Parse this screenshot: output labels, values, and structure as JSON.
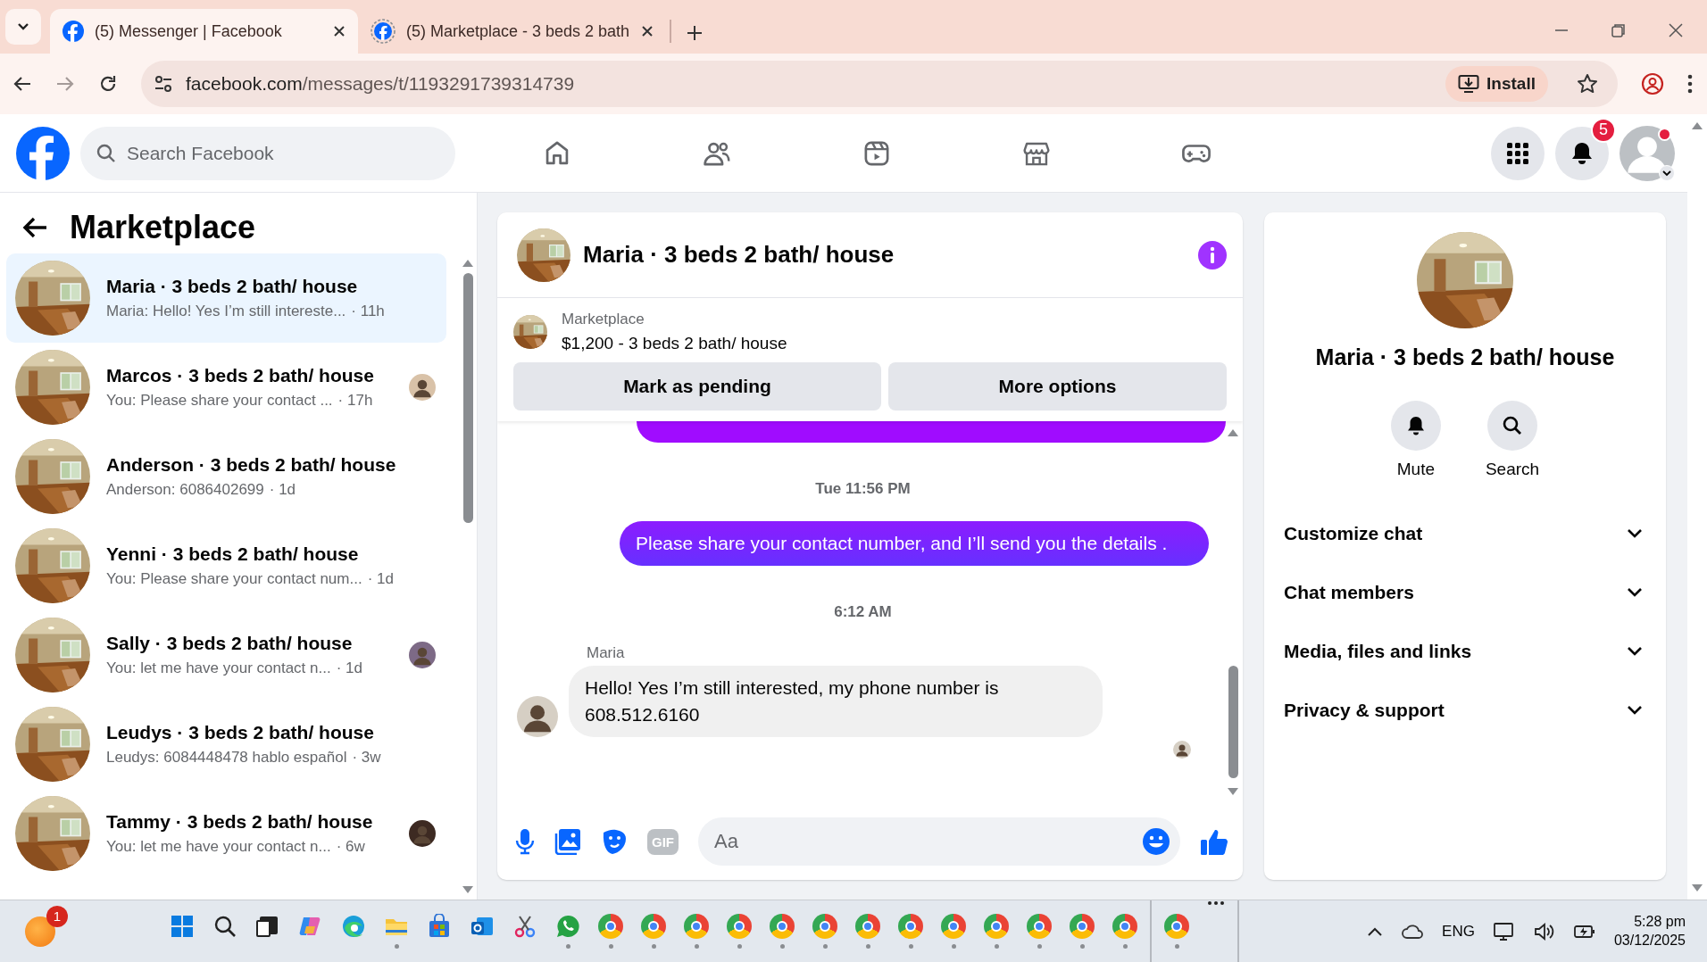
{
  "browser": {
    "tabs": [
      {
        "title": "(5) Messenger | Facebook",
        "selected": true,
        "loading": false
      },
      {
        "title": "(5) Marketplace - 3 beds 2 bath",
        "selected": false,
        "loading": true
      }
    ],
    "url_host": "facebook.com",
    "url_path": "/messages/t/1193291739314739",
    "install_label": "Install"
  },
  "header": {
    "search_placeholder": "Search Facebook",
    "nav": [
      {
        "kind": "home"
      },
      {
        "kind": "friends"
      },
      {
        "kind": "video"
      },
      {
        "kind": "marketplace"
      },
      {
        "kind": "gaming"
      }
    ],
    "notifications_badge": "5"
  },
  "sidebar": {
    "title": "Marketplace",
    "chats": [
      {
        "name": "Maria · 3 beds 2 bath/ house",
        "preview": "Maria: Hello! Yes I’m still intereste...",
        "time": "· 11h",
        "selected": true,
        "seen": false
      },
      {
        "name": "Marcos · 3 beds 2 bath/ house",
        "preview": "You: Please share your contact ...",
        "time": "· 17h",
        "selected": false,
        "seen": true
      },
      {
        "name": "Anderson · 3 beds 2 bath/ house",
        "preview": "Anderson: 6086402699",
        "time": "· 1d",
        "selected": false,
        "seen": false
      },
      {
        "name": "Yenni · 3 beds 2 bath/ house",
        "preview": "You: Please share your contact num...",
        "time": "· 1d",
        "selected": false,
        "seen": false
      },
      {
        "name": "Sally · 3 beds 2 bath/ house",
        "preview": "You: let me have your contact n...",
        "time": "· 1d",
        "selected": false,
        "seen": true
      },
      {
        "name": "Leudys · 3 beds 2 bath/ house",
        "preview": "Leudys: 6084448478 hablo español",
        "time": "· 3w",
        "selected": false,
        "seen": false
      },
      {
        "name": "Tammy · 3 beds 2 bath/ house",
        "preview": "You: let me have your contact n...",
        "time": "· 6w",
        "selected": false,
        "seen": true
      }
    ]
  },
  "chat": {
    "title": "Maria · 3 beds 2 bath/ house",
    "listing": {
      "label": "Marketplace",
      "title": "$1,200 - 3 beds 2 bath/ house"
    },
    "actions": [
      "Mark as pending",
      "More options"
    ],
    "messages": [
      {
        "kind": "sent_fragment"
      },
      {
        "kind": "time",
        "text": "Tue 11:56 PM"
      },
      {
        "kind": "sent",
        "text": "Please share your contact number, and I’ll send you the details ."
      },
      {
        "kind": "time",
        "text": "6:12 AM"
      },
      {
        "kind": "received",
        "sender": "Maria",
        "text": "Hello! Yes I’m still interested, my phone number is 608.512.6160"
      },
      {
        "kind": "seen"
      }
    ],
    "composer": {
      "gif_label": "GIF",
      "placeholder": "Aa"
    }
  },
  "info": {
    "title": "Maria · 3 beds 2 bath/ house",
    "actions": [
      {
        "kind": "mute",
        "label": "Mute"
      },
      {
        "kind": "search",
        "label": "Search"
      }
    ],
    "sections": [
      {
        "label": "Customize chat",
        "expanded": false
      },
      {
        "label": "Chat members",
        "expanded": false
      },
      {
        "label": "Media, files and links",
        "expanded": false
      },
      {
        "label": "Privacy & support",
        "expanded": false
      }
    ]
  },
  "taskbar": {
    "weather_badge": "1",
    "apps": [
      {
        "kind": "start",
        "running": false
      },
      {
        "kind": "search",
        "running": false
      },
      {
        "kind": "taskview",
        "running": false
      },
      {
        "kind": "copilot",
        "running": false
      },
      {
        "kind": "edge",
        "running": false
      },
      {
        "kind": "folder",
        "running": true
      },
      {
        "kind": "store",
        "running": false
      },
      {
        "kind": "mail",
        "running": false
      },
      {
        "kind": "snip",
        "running": false
      },
      {
        "kind": "chat",
        "running": true
      },
      {
        "kind": "chrome",
        "running": true
      },
      {
        "kind": "chrome",
        "running": true
      },
      {
        "kind": "chrome",
        "running": true
      },
      {
        "kind": "chrome",
        "running": true
      },
      {
        "kind": "chrome",
        "running": true
      },
      {
        "kind": "chrome",
        "running": true
      },
      {
        "kind": "chrome",
        "running": true
      },
      {
        "kind": "chrome",
        "running": true
      },
      {
        "kind": "chrome",
        "running": true
      },
      {
        "kind": "chrome",
        "running": true
      },
      {
        "kind": "chrome",
        "running": true
      },
      {
        "kind": "chrome",
        "running": true
      },
      {
        "kind": "chrome",
        "running": true
      }
    ],
    "extra_apps": [
      {
        "kind": "chrome",
        "running": true
      }
    ],
    "tray": {
      "language": "ENG",
      "time": "5:28 pm",
      "date": "03/12/2025"
    }
  }
}
